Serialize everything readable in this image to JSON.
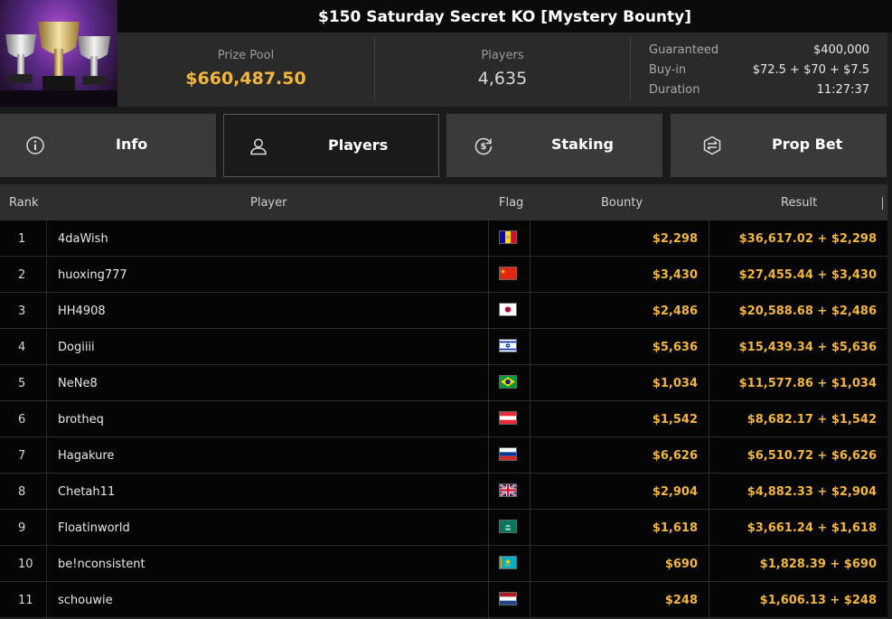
{
  "header": {
    "title": "$150 Saturday Secret KO [Mystery Bounty]",
    "prize_pool_label": "Prize Pool",
    "prize_pool_value": "$660,487.50",
    "players_label": "Players",
    "players_value": "4,635",
    "details": [
      {
        "label": "Guaranteed",
        "value": "$400,000"
      },
      {
        "label": "Buy-in",
        "value": "$72.5 + $70 + $7.5"
      },
      {
        "label": "Duration",
        "value": "11:27:37"
      }
    ]
  },
  "tabs": [
    {
      "label": "Info",
      "icon": "info-icon"
    },
    {
      "label": "Players",
      "icon": "user-icon",
      "active": true
    },
    {
      "label": "Staking",
      "icon": "dollar-refresh-icon"
    },
    {
      "label": "Prop Bet",
      "icon": "prop-bet-icon"
    }
  ],
  "table": {
    "columns": [
      "Rank",
      "Player",
      "Flag",
      "Bounty",
      "Result"
    ],
    "rows": [
      {
        "rank": "1",
        "player": "4daWish",
        "flag": "andorra",
        "bounty": "$2,298",
        "result": "$36,617.02 + $2,298"
      },
      {
        "rank": "2",
        "player": "huoxing777",
        "flag": "china",
        "bounty": "$3,430",
        "result": "$27,455.44 + $3,430"
      },
      {
        "rank": "3",
        "player": "HH4908",
        "flag": "japan",
        "bounty": "$2,486",
        "result": "$20,588.68 + $2,486"
      },
      {
        "rank": "4",
        "player": "Dogiiii",
        "flag": "israel",
        "bounty": "$5,636",
        "result": "$15,439.34 + $5,636"
      },
      {
        "rank": "5",
        "player": "NeNe8",
        "flag": "brazil",
        "bounty": "$1,034",
        "result": "$11,577.86 + $1,034"
      },
      {
        "rank": "6",
        "player": "brotheq",
        "flag": "austria",
        "bounty": "$1,542",
        "result": "$8,682.17 + $1,542"
      },
      {
        "rank": "7",
        "player": "Hagakure",
        "flag": "russia",
        "bounty": "$6,626",
        "result": "$6,510.72 + $6,626"
      },
      {
        "rank": "8",
        "player": "Chetah11",
        "flag": "united-kingdom",
        "bounty": "$2,904",
        "result": "$4,882.33 + $2,904"
      },
      {
        "rank": "9",
        "player": "Floatinworld",
        "flag": "macau",
        "bounty": "$1,618",
        "result": "$3,661.24 + $1,618"
      },
      {
        "rank": "10",
        "player": "be!nconsistent",
        "flag": "kazakhstan",
        "bounty": "$690",
        "result": "$1,828.39 + $690"
      },
      {
        "rank": "11",
        "player": "schouwie",
        "flag": "netherlands",
        "bounty": "$248",
        "result": "$1,606.13 + $248"
      }
    ]
  },
  "colors": {
    "accent_gold": "#f2b63d",
    "background": "#050505",
    "tab_bg": "#3a3a3a"
  }
}
